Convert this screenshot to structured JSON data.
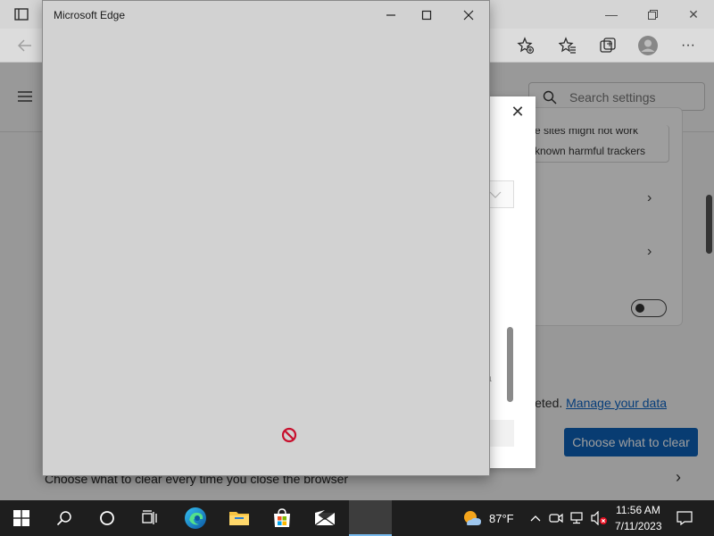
{
  "foreground_window": {
    "title": "Microsoft Edge"
  },
  "background_edge": {
    "search_placeholder": "Search settings",
    "card": {
      "line1": "e sites might not work",
      "line2": "known harmful trackers"
    },
    "dialog_partial_text_1": "t",
    "dialog_partial_text_2": "a",
    "manage_prefix": "leted.",
    "manage_link": "Manage your data",
    "choose_button": "Choose what to clear",
    "bottom_row": "Choose what to clear every time you close the browser"
  },
  "taskbar": {
    "weather_temp": "87°F",
    "time": "11:56 AM",
    "date": "7/11/2023"
  },
  "colors": {
    "accent": "#0e62b8",
    "link": "#0b63c6",
    "blocked_icon": "#c8102e",
    "taskbar": "#1e1e1e"
  }
}
